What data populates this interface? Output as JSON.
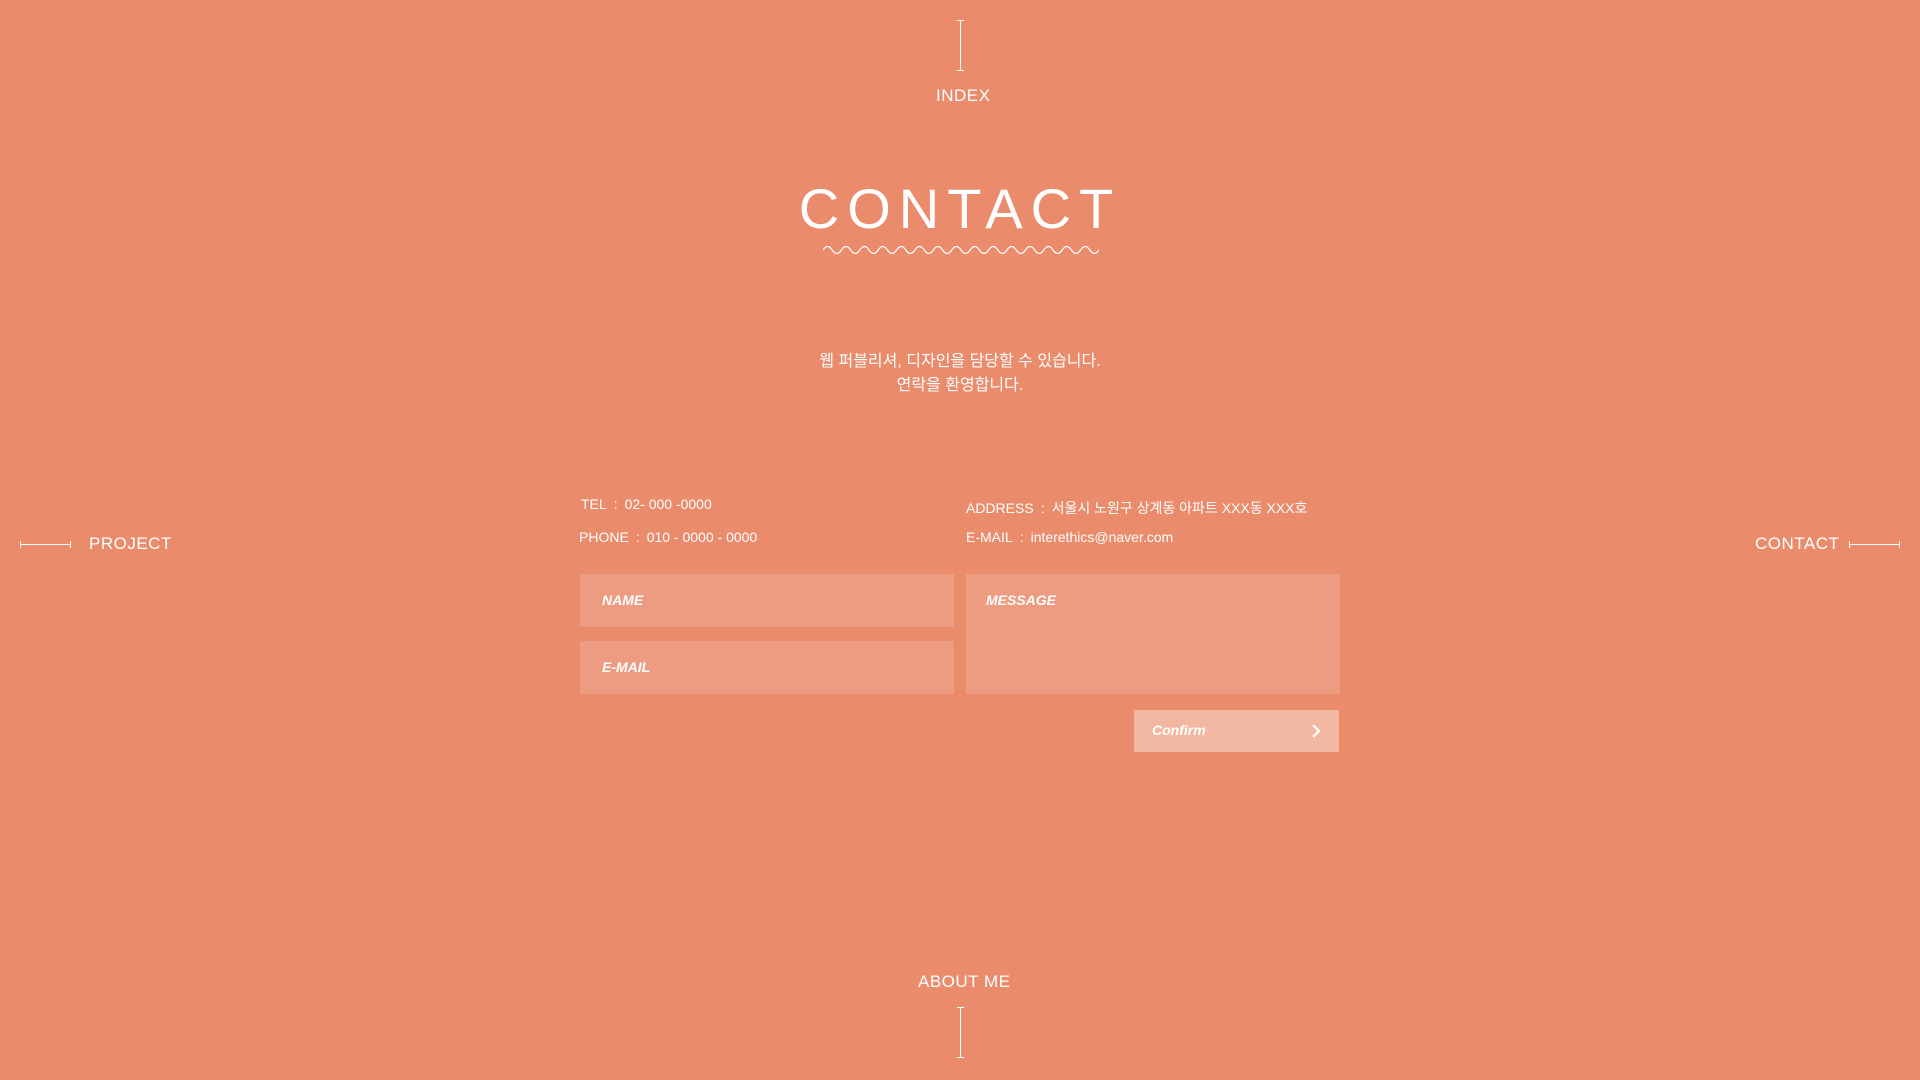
{
  "nav": {
    "top_label": "INDEX",
    "bottom_label": "ABOUT ME",
    "left_label": "PROJECT",
    "right_label": "CONTACT"
  },
  "title": "CONTACT",
  "intro": {
    "line1": "웹 퍼블리셔, 디자인을 담당할 수 있습니다.",
    "line2": "연락을 환영합니다."
  },
  "contact_info": {
    "tel_label": "TEL",
    "tel_value": "02- 000 -0000",
    "phone_label": "PHONE",
    "phone_value": "010 - 0000 - 0000",
    "address_label": "ADDRESS",
    "address_value": "서울시 노원구 상계동 아파트 XXX동 XXX호",
    "email_label": "E-MAIL",
    "email_value": "interethics@naver.com",
    "separator": ":"
  },
  "form": {
    "name_placeholder": "NAME",
    "email_placeholder": "E-MAIL",
    "message_placeholder": "MESSAGE",
    "confirm_label": "Confirm"
  },
  "colors": {
    "background": "#ea8b6b",
    "field": "rgba(255,255,255,0.15)",
    "button": "#f2b7a1",
    "text": "#ffffff"
  },
  "icons": {
    "confirm_arrow": "chevron-right-icon",
    "title_decoration": "wave-underline-icon"
  }
}
